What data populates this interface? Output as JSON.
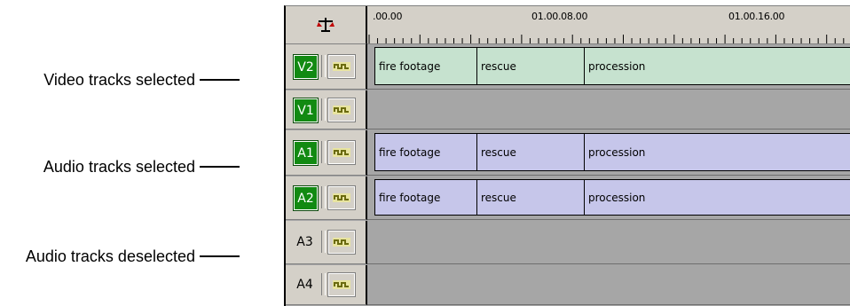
{
  "callouts": {
    "video_selected": "Video tracks selected",
    "audio_selected": "Audio tracks selected",
    "audio_deselected": "Audio tracks deselected"
  },
  "ruler": {
    "head_icon": "scales-icon",
    "timecodes": [
      ".00.00",
      "01.00.08.00",
      "01.00.16.00"
    ]
  },
  "tracks": [
    {
      "label": "V2",
      "selected": true,
      "type": "video",
      "clips": [
        "fire footage",
        "rescue",
        "procession"
      ]
    },
    {
      "label": "V1",
      "selected": true,
      "type": "video",
      "clips": []
    },
    {
      "label": "A1",
      "selected": true,
      "type": "audio",
      "clips": [
        "fire footage",
        "rescue",
        "procession"
      ]
    },
    {
      "label": "A2",
      "selected": true,
      "type": "audio",
      "clips": [
        "fire footage",
        "rescue",
        "procession"
      ]
    },
    {
      "label": "A3",
      "selected": false,
      "type": "audio",
      "clips": []
    },
    {
      "label": "A4",
      "selected": false,
      "type": "audio",
      "clips": []
    }
  ],
  "colors": {
    "selected_button": "#128a12",
    "video_clip": "#c6e2cf",
    "audio_clip": "#c6c6ea",
    "empty_lane": "#a6a6a6",
    "panel": "#d4d0c8"
  },
  "icons": {
    "monitor": "monitor-speaker-icon"
  }
}
